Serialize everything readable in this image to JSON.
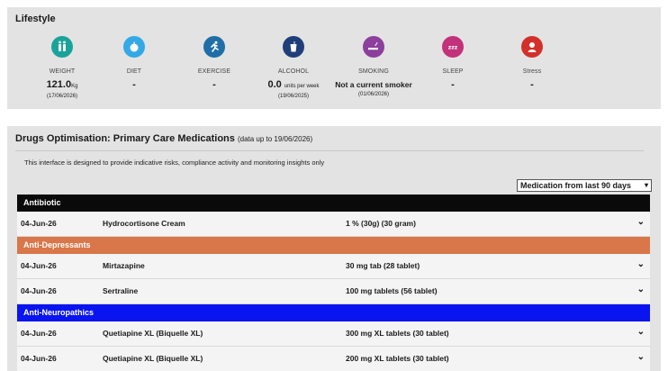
{
  "lifestyle": {
    "title": "Lifestyle",
    "metrics": [
      {
        "label": "WEIGHT",
        "value": "121.0",
        "unit": "Kg",
        "date": "(17/06/2026)",
        "icon": "weight-icon",
        "color": "#1aa39a"
      },
      {
        "label": "DIET",
        "value": "-",
        "unit": "",
        "date": "",
        "icon": "apple-icon",
        "color": "#33a9e6"
      },
      {
        "label": "EXERCISE",
        "value": "-",
        "unit": "",
        "date": "",
        "icon": "running-icon",
        "color": "#1f6ea8"
      },
      {
        "label": "ALCOHOL",
        "value": "0.0",
        "unit": "units per week",
        "date": "(19/06/2025)",
        "icon": "drink-icon",
        "color": "#203e7a"
      },
      {
        "label": "SMOKING",
        "value": "Not a current smoker",
        "unit": "",
        "date": "(01/06/2026)",
        "icon": "cigarette-icon",
        "color": "#8c3f9c"
      },
      {
        "label": "SLEEP",
        "value": "-",
        "unit": "",
        "date": "",
        "icon": "sleep-icon",
        "color": "#c2317a"
      },
      {
        "label": "Stress",
        "value": "-",
        "unit": "",
        "date": "",
        "icon": "stress-icon",
        "color": "#d3302a"
      }
    ]
  },
  "drugs": {
    "title": "Drugs Optimisation: Primary Care Medications",
    "subtitle": "(data up to 19/06/2026)",
    "note": "This interface is designed to provide indicative risks, compliance activity and monitoring insights only",
    "filter": "Medication from last 90 days",
    "categories": [
      {
        "name": "Antibiotic",
        "color": "#0a0a0a",
        "rows": [
          {
            "date": "04-Jun-26",
            "name": "Hydrocortisone Cream",
            "dose": "1 % (30g) (30 gram)"
          }
        ]
      },
      {
        "name": "Anti-Depressants",
        "color": "#d9774a",
        "rows": [
          {
            "date": "04-Jun-26",
            "name": "Mirtazapine",
            "dose": "30 mg tab (28 tablet)"
          },
          {
            "date": "04-Jun-26",
            "name": "Sertraline",
            "dose": "100 mg tablets (56 tablet)"
          }
        ]
      },
      {
        "name": "Anti-Neuropathics",
        "color": "#0a14f0",
        "rows": [
          {
            "date": "04-Jun-26",
            "name": "Quetiapine XL (Biquelle XL)",
            "dose": "300 mg XL tablets (30 tablet)"
          },
          {
            "date": "04-Jun-26",
            "name": "Quetiapine XL (Biquelle XL)",
            "dose": "200 mg XL tablets (30 tablet)"
          }
        ]
      }
    ]
  }
}
